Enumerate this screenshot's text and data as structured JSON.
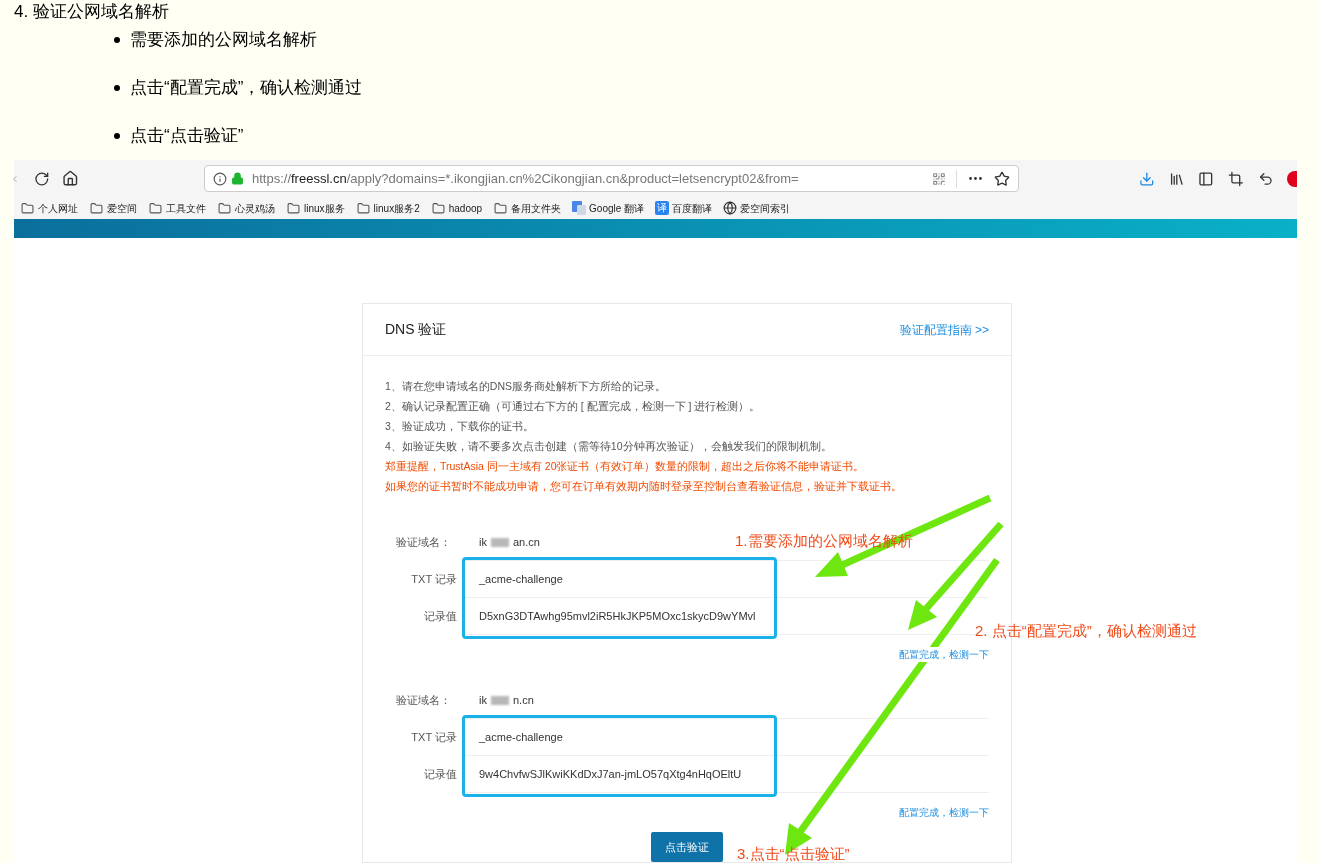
{
  "doc": {
    "heading": "4. 验证公网域名解析",
    "bullets": [
      "需要添加的公网域名解析",
      "点击“配置完成”，确认检测通过",
      "点击“点击验证”"
    ]
  },
  "browser": {
    "url_prefix": "https://",
    "url_host": "freessl.cn",
    "url_rest": "/apply?domains=*.ikongjian.cn%2Cikongjian.cn&product=letsencrypt02&from=",
    "bookmarks": [
      {
        "label": "个人网址",
        "kind": "folder"
      },
      {
        "label": "爱空间",
        "kind": "folder"
      },
      {
        "label": "工具文件",
        "kind": "folder"
      },
      {
        "label": "心灵鸡汤",
        "kind": "folder"
      },
      {
        "label": "linux服务",
        "kind": "folder"
      },
      {
        "label": "linux服务2",
        "kind": "folder"
      },
      {
        "label": "hadoop",
        "kind": "folder"
      },
      {
        "label": "备用文件夹",
        "kind": "folder"
      },
      {
        "label": "Google 翻译",
        "kind": "google"
      },
      {
        "label": "百度翻译",
        "kind": "badge",
        "icon_text": "译"
      },
      {
        "label": "爱空间索引",
        "kind": "globe"
      }
    ]
  },
  "card": {
    "title": "DNS 验证",
    "guide_link": "验证配置指南 >>",
    "instructions": [
      {
        "text": "1、请在您申请域名的DNS服务商处解析下方所给的记录。",
        "kind": "normal"
      },
      {
        "text": "2、确认记录配置正确（可通过右下方的 [ 配置完成，检测一下 ] 进行检测）。",
        "kind": "normal"
      },
      {
        "text": "3、验证成功，下载你的证书。",
        "kind": "normal"
      },
      {
        "text": "4、如验证失败，请不要多次点击创建（需等待10分钟再次验证），会触发我们的限制机制。",
        "kind": "normal"
      },
      {
        "text": "郑重提醒，TrustAsia 同一主域有 20张证书（有效订单）数量的限制，超出之后你将不能申请证书。",
        "kind": "warning"
      },
      {
        "text": "如果您的证书暂时不能成功申请，您可在订单有效期内随时登录至控制台查看验证信息，验证并下载证书。",
        "kind": "warning"
      }
    ],
    "records": [
      {
        "domain_label": "验证域名：",
        "domain_prefix": "ik",
        "domain_suffix": "an.cn",
        "txt_label": "TXT 记录",
        "txt": "_acme-challenge",
        "value_label": "记录值",
        "value": "D5xnG3DTAwhg95mvl2iR5HkJKP5MOxc1skycD9wYMvl",
        "check_link": "配置完成，检测一下"
      },
      {
        "domain_label": "验证域名：",
        "domain_prefix": "ik",
        "domain_suffix": "n.cn",
        "txt_label": "TXT 记录",
        "txt": "_acme-challenge",
        "value_label": "记录值",
        "value": "9w4ChvfwSJlKwiKKdDxJ7an-jmLO57qXtg4nHqOEltU",
        "check_link": "配置完成，检测一下"
      }
    ],
    "submit": "点击验证"
  },
  "annotations": [
    "1.需要添加的公网域名解析",
    "2. 点击“配置完成”，确认检测通过",
    "3.点击“点击验证”"
  ]
}
